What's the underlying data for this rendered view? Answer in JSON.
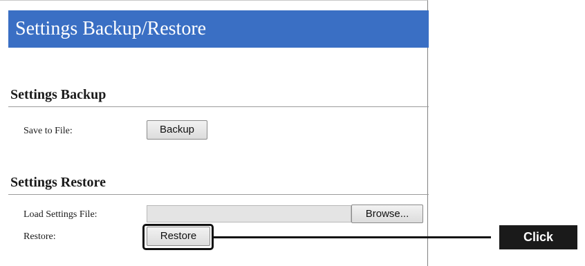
{
  "header": {
    "title": "Settings Backup/Restore"
  },
  "backup": {
    "section_title": "Settings Backup",
    "save_label": "Save to File:",
    "backup_button": "Backup"
  },
  "restore": {
    "section_title": "Settings Restore",
    "load_label": "Load Settings File:",
    "file_value": "",
    "browse_button": "Browse...",
    "restore_label": "Restore:",
    "restore_button": "Restore"
  },
  "annotation": {
    "callout_text": "Click"
  },
  "colors": {
    "header_bg": "#3a6fc4",
    "callout_bg": "#1a1a1a"
  }
}
